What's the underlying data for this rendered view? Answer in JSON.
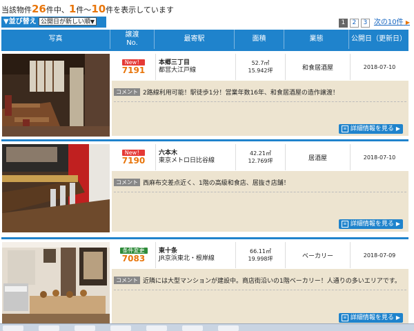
{
  "summary": {
    "prefix": "当該物件",
    "total": "26",
    "mid1": "件中、",
    "from": "1",
    "mid2": "件～",
    "to": "10",
    "suffix": "件を表示しています"
  },
  "sort": {
    "label": "▼並び替え",
    "selected": "公開日が新しい順"
  },
  "pager": {
    "pages": [
      "1",
      "2",
      "3"
    ],
    "current": "1",
    "next": "次の10件"
  },
  "columns": [
    "写真",
    "譲渡 No.",
    "最寄駅",
    "面積",
    "業態",
    "公開日（更新日）"
  ],
  "listings": [
    {
      "badge": "New！",
      "badge_color": "#e53935",
      "no": "7191",
      "station": "本郷三丁目",
      "line": "都営大江戸線",
      "area_m2": "52.7㎡",
      "area_tsubo": "15.942坪",
      "type": "和食居酒屋",
      "date": "2018-07-10",
      "comment_tag": "コメント",
      "comment": "2路線利用可能！駅徒歩1分！営業年数16年、和食居酒屋の造作譲渡！",
      "detail": "詳細情報を見る"
    },
    {
      "badge": "New！",
      "badge_color": "#e53935",
      "no": "7190",
      "station": "六本木",
      "line": "東京メトロ日比谷線",
      "area_m2": "42.21㎡",
      "area_tsubo": "12.769坪",
      "type": "居酒屋",
      "date": "2018-07-10",
      "comment_tag": "コメント",
      "comment": "西麻布交差点近く、1階の高級和食店、居抜き店舗！",
      "detail": "詳細情報を見る"
    },
    {
      "badge": "条件変更",
      "badge_color": "#2e8b3a",
      "no": "7083",
      "station": "東十条",
      "line": "JR京浜東北・根岸線",
      "area_m2": "66.11㎡",
      "area_tsubo": "19.998坪",
      "type": "ベーカリー",
      "date": "2018-07-09",
      "comment_tag": "コメント",
      "comment": "近隣には大型マンションが建設中。商店街沿いの1階ベーカリー！人通りの多いエリアです。",
      "detail": "詳細情報を見る"
    }
  ],
  "colors": {
    "header_blue": "#1f83cc",
    "accent_orange": "#e8750a",
    "comment_bg": "#ede4d0"
  }
}
